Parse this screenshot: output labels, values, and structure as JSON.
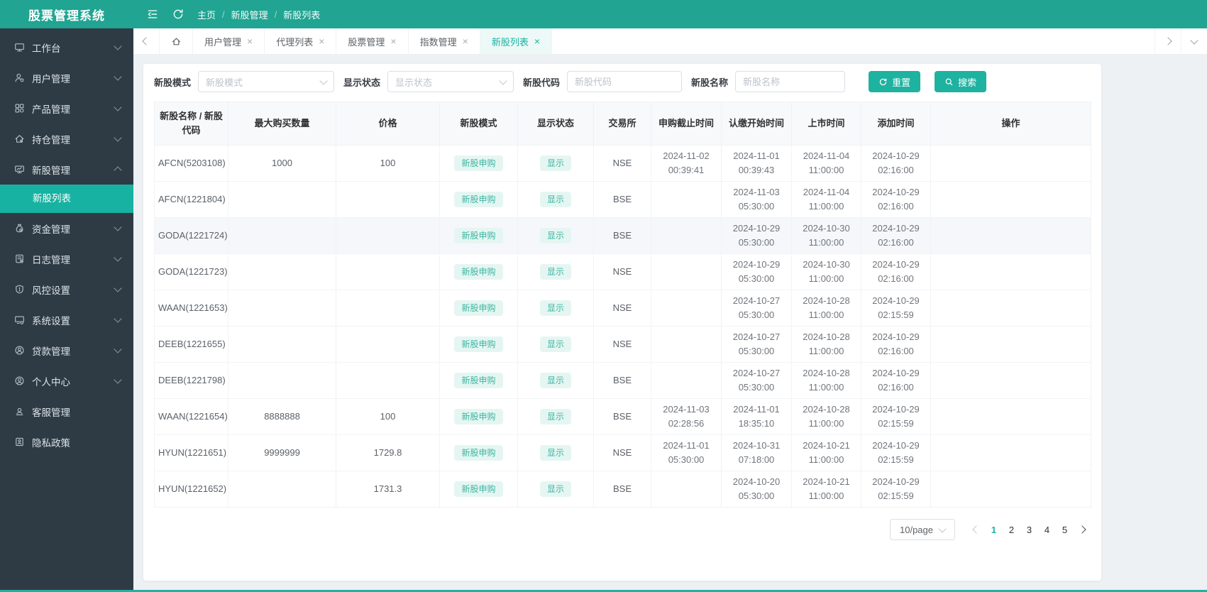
{
  "app": {
    "title": "股票管理系统"
  },
  "header": {
    "breadcrumb": [
      "主页",
      "新股管理",
      "新股列表"
    ],
    "icons": [
      "collapse-sidebar-icon",
      "refresh-icon"
    ]
  },
  "colors": {
    "primary_teal": "#1eb2a0",
    "header_bg": "#21a492",
    "sidebar_bg": "#2e3b45",
    "sidebar_active_bg": "#17b2a2",
    "badge_bg": "#e5f6f2",
    "badge_text": "#3cb5a1",
    "content_bg": "#eef1f4"
  },
  "sidebar": {
    "items": [
      {
        "id": "workbench",
        "label": "工作台",
        "icon": "monitor-icon",
        "chevron": "down"
      },
      {
        "id": "user-management",
        "label": "用户管理",
        "icon": "user-gear-icon",
        "chevron": "down"
      },
      {
        "id": "product-management",
        "label": "产品管理",
        "icon": "grid-icon",
        "chevron": "down"
      },
      {
        "id": "position-management",
        "label": "持仓管理",
        "icon": "home-icon",
        "chevron": "down"
      },
      {
        "id": "ipo-management",
        "label": "新股管理",
        "icon": "monitor-chart-icon",
        "chevron": "up",
        "children": [
          {
            "id": "ipo-list",
            "label": "新股列表",
            "active": true
          }
        ]
      },
      {
        "id": "funds-management",
        "label": "资金管理",
        "icon": "money-bag-icon",
        "chevron": "down"
      },
      {
        "id": "log-management",
        "label": "日志管理",
        "icon": "notebook-icon",
        "chevron": "down"
      },
      {
        "id": "risk-settings",
        "label": "风控设置",
        "icon": "shield-icon",
        "chevron": "down"
      },
      {
        "id": "system-settings",
        "label": "系统设置",
        "icon": "monitor-gear-icon",
        "chevron": "down"
      },
      {
        "id": "loan-management",
        "label": "贷款管理",
        "icon": "coin-user-icon",
        "chevron": "down"
      },
      {
        "id": "profile-center",
        "label": "个人中心",
        "icon": "user-circle-icon",
        "chevron": "down"
      },
      {
        "id": "service-management",
        "label": "客服管理",
        "icon": "headset-icon",
        "chevron": "none"
      },
      {
        "id": "privacy-policy",
        "label": "隐私政策",
        "icon": "id-card-icon",
        "chevron": "none"
      }
    ]
  },
  "tabs": [
    {
      "label": "用户管理",
      "closable": true,
      "active": false
    },
    {
      "label": "代理列表",
      "closable": true,
      "active": false
    },
    {
      "label": "股票管理",
      "closable": true,
      "active": false
    },
    {
      "label": "指数管理",
      "closable": true,
      "active": false
    },
    {
      "label": "新股列表",
      "closable": true,
      "active": true
    }
  ],
  "filters": {
    "mode": {
      "label": "新股模式",
      "placeholder": "新股模式"
    },
    "status": {
      "label": "显示状态",
      "placeholder": "显示状态"
    },
    "code": {
      "label": "新股代码",
      "placeholder": "新股代码"
    },
    "name": {
      "label": "新股名称",
      "placeholder": "新股名称"
    },
    "reset_label": "重置",
    "search_label": "搜索"
  },
  "table": {
    "columns": [
      "新股名称 / 新股代码",
      "最大购买数量",
      "价格",
      "新股模式",
      "显示状态",
      "交易所",
      "申购截止时间",
      "认缴开始时间",
      "上市时间",
      "添加时间",
      "操作"
    ],
    "rows": [
      {
        "name": "AFCN(5203108)",
        "max_buy": "1000",
        "price": "100",
        "mode": "新股申购",
        "status": "显示",
        "exchange": "NSE",
        "deadline": "2024-11-02 00:39:41",
        "subscribe_start": "2024-11-01 00:39:43",
        "listing": "2024-11-04 11:00:00",
        "added": "2024-10-29 02:16:00",
        "actions": "",
        "hover": false
      },
      {
        "name": "AFCN(1221804)",
        "max_buy": "",
        "price": "",
        "mode": "新股申购",
        "status": "显示",
        "exchange": "BSE",
        "deadline": "",
        "subscribe_start": "2024-11-03 05:30:00",
        "listing": "2024-11-04 11:00:00",
        "added": "2024-10-29 02:16:00",
        "actions": "",
        "hover": false
      },
      {
        "name": "GODA(1221724)",
        "max_buy": "",
        "price": "",
        "mode": "新股申购",
        "status": "显示",
        "exchange": "BSE",
        "deadline": "",
        "subscribe_start": "2024-10-29 05:30:00",
        "listing": "2024-10-30 11:00:00",
        "added": "2024-10-29 02:16:00",
        "actions": "",
        "hover": true
      },
      {
        "name": "GODA(1221723)",
        "max_buy": "",
        "price": "",
        "mode": "新股申购",
        "status": "显示",
        "exchange": "NSE",
        "deadline": "",
        "subscribe_start": "2024-10-29 05:30:00",
        "listing": "2024-10-30 11:00:00",
        "added": "2024-10-29 02:16:00",
        "actions": "",
        "hover": false
      },
      {
        "name": "WAAN(1221653)",
        "max_buy": "",
        "price": "",
        "mode": "新股申购",
        "status": "显示",
        "exchange": "NSE",
        "deadline": "",
        "subscribe_start": "2024-10-27 05:30:00",
        "listing": "2024-10-28 11:00:00",
        "added": "2024-10-29 02:15:59",
        "actions": "",
        "hover": false
      },
      {
        "name": "DEEB(1221655)",
        "max_buy": "",
        "price": "",
        "mode": "新股申购",
        "status": "显示",
        "exchange": "NSE",
        "deadline": "",
        "subscribe_start": "2024-10-27 05:30:00",
        "listing": "2024-10-28 11:00:00",
        "added": "2024-10-29 02:16:00",
        "actions": "",
        "hover": false
      },
      {
        "name": "DEEB(1221798)",
        "max_buy": "",
        "price": "",
        "mode": "新股申购",
        "status": "显示",
        "exchange": "BSE",
        "deadline": "",
        "subscribe_start": "2024-10-27 05:30:00",
        "listing": "2024-10-28 11:00:00",
        "added": "2024-10-29 02:16:00",
        "actions": "",
        "hover": false
      },
      {
        "name": "WAAN(1221654)",
        "max_buy": "8888888",
        "price": "100",
        "mode": "新股申购",
        "status": "显示",
        "exchange": "BSE",
        "deadline": "2024-11-03 02:28:56",
        "subscribe_start": "2024-11-01 18:35:10",
        "listing": "2024-10-28 11:00:00",
        "added": "2024-10-29 02:15:59",
        "actions": "",
        "hover": false
      },
      {
        "name": "HYUN(1221651)",
        "max_buy": "9999999",
        "price": "1729.8",
        "mode": "新股申购",
        "status": "显示",
        "exchange": "NSE",
        "deadline": "2024-11-01 05:30:00",
        "subscribe_start": "2024-10-31 07:18:00",
        "listing": "2024-10-21 11:00:00",
        "added": "2024-10-29 02:15:59",
        "actions": "",
        "hover": false
      },
      {
        "name": "HYUN(1221652)",
        "max_buy": "",
        "price": "1731.3",
        "mode": "新股申购",
        "status": "显示",
        "exchange": "BSE",
        "deadline": "",
        "subscribe_start": "2024-10-20 05:30:00",
        "listing": "2024-10-21 11:00:00",
        "added": "2024-10-29 02:15:59",
        "actions": "",
        "hover": false
      }
    ]
  },
  "pagination": {
    "size_label": "10/page",
    "pages": [
      "1",
      "2",
      "3",
      "4",
      "5"
    ],
    "active_page": "1"
  }
}
